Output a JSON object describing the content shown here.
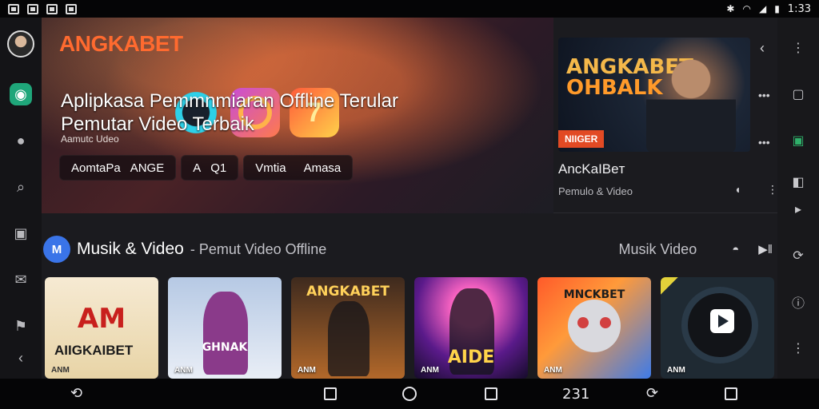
{
  "status": {
    "left_icons": [
      "gallery-icon",
      "mail-icon",
      "mail-icon",
      "photo-icon"
    ],
    "right_icons": [
      "bluetooth-icon",
      "wifi-icon",
      "signal-icon",
      "battery-icon"
    ],
    "time": "1:33"
  },
  "rail": {
    "left_icons": [
      "avatar",
      "chat-app-icon",
      "message-icon",
      "search-icon",
      "cast-icon",
      "mail-icon",
      "flag-icon",
      "back-icon"
    ],
    "right_icons": [
      "more-vert-icon",
      "square-icon",
      "screen-icon",
      "window-icon",
      "play-icon",
      "rotate-icon",
      "info-icon",
      "more-vert-icon"
    ]
  },
  "hero": {
    "brand": "ANGKABET",
    "title_line1": "Aplipkasa Pemmnmiaran Offline Terular",
    "title_line2": "Pemutar Video Terbaik",
    "subtitle": "Aamutc Udeo",
    "chips": [
      "AomtaPa",
      "ANGE",
      "A",
      "Q1",
      "Vmtia",
      "Amasa"
    ]
  },
  "featured": {
    "thumb_title_1": "ANGKABET",
    "thumb_title_2": "OHBALK",
    "badge": "NIIGER",
    "name": "AncKaIBeт",
    "desc": "Pemulo & Video"
  },
  "section": {
    "logo": "M",
    "title": "Musik & Video",
    "subtitle": "- Pemut Video Offline",
    "right_label": "Musik Video"
  },
  "cards": [
    {
      "big": "AM",
      "big2": "AIIGKAIBET",
      "cap": "ANM"
    },
    {
      "big": "GHNAK",
      "cap": "ANM"
    },
    {
      "big": "ANGKABET",
      "cap": "ANM"
    },
    {
      "big": "AIDE",
      "cap": "ANM"
    },
    {
      "big": "MNCKBET",
      "cap": "ANM"
    },
    {
      "big": "",
      "cap": "ANM"
    }
  ],
  "navbar": {
    "back": "⟲",
    "center_label": "231"
  }
}
